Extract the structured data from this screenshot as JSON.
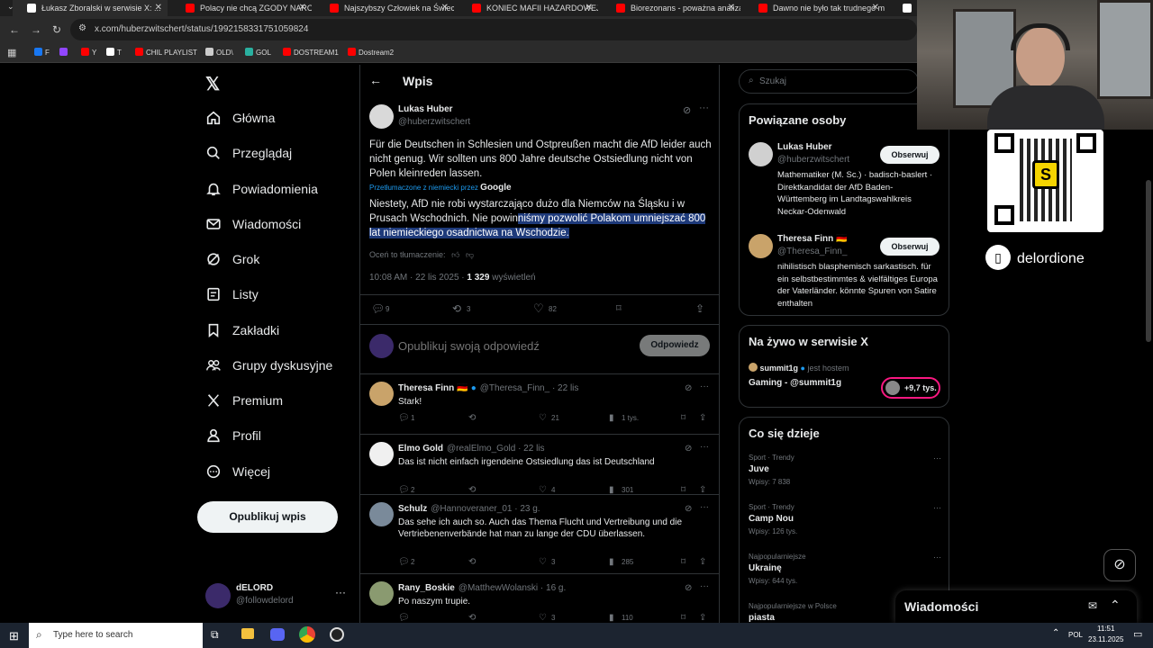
{
  "browser": {
    "tabs": [
      {
        "title": "Łukasz Zboralski w serwisie X: ...",
        "color": "#ffffff"
      },
      {
        "title": "Polacy nie chcą ZGODY NARODOWEJ",
        "color": "#ff0000"
      },
      {
        "title": "Najszybszy Człowiek na Świecie",
        "color": "#ff0000"
      },
      {
        "title": "KONIEC MAFII HAZARDOWEJ",
        "color": "#ff0000"
      },
      {
        "title": "Biorezonans - poważna analiza",
        "color": "#ff0000"
      },
      {
        "title": "Dawno nie było tak trudnego m",
        "color": "#ff0000"
      },
      {
        "title": "Łuka",
        "color": "#ffffff"
      }
    ],
    "url": "x.com/huberzwitschert/status/1992158331751059824",
    "bookmarks": [
      {
        "label": "F",
        "color": "#1877f2"
      },
      {
        "label": "",
        "color": "#9146ff"
      },
      {
        "label": "Y",
        "color": "#ff0000"
      },
      {
        "label": "T",
        "color": "#ffffff"
      },
      {
        "label": "CHIL PLAYLIST",
        "color": "#ff0000"
      },
      {
        "label": "OLD\\",
        "color": "#cccccc"
      },
      {
        "label": "GOL",
        "color": "#2ab0a0"
      },
      {
        "label": "DOSTREAM1",
        "color": "#ff0000"
      },
      {
        "label": "Dostream2",
        "color": "#ff0000"
      }
    ]
  },
  "sidebar": {
    "items": [
      {
        "label": "Główna",
        "icon": "home-icon"
      },
      {
        "label": "Przeglądaj",
        "icon": "search-icon"
      },
      {
        "label": "Powiadomienia",
        "icon": "bell-icon"
      },
      {
        "label": "Wiadomości",
        "icon": "mail-icon"
      },
      {
        "label": "Grok",
        "icon": "grok-icon"
      },
      {
        "label": "Listy",
        "icon": "list-icon"
      },
      {
        "label": "Zakładki",
        "icon": "bookmark-icon"
      },
      {
        "label": "Grupy dyskusyjne",
        "icon": "community-icon"
      },
      {
        "label": "Premium",
        "icon": "x-logo-icon"
      },
      {
        "label": "Profil",
        "icon": "person-icon"
      },
      {
        "label": "Więcej",
        "icon": "more-circle-icon"
      }
    ],
    "post_button": "Opublikuj wpis",
    "account": {
      "name": "dELORD",
      "handle": "@followdelord"
    }
  },
  "post": {
    "header": "Wpis",
    "author": "Lukas Huber",
    "handle": "@huberzwitschert",
    "text_de": "Für die Deutschen in Schlesien und Ostpreußen macht die AfD leider auch nicht genug. Wir sollten uns 800 Jahre deutsche Ostsiedlung nicht von Polen kleinreden lassen.",
    "translated_label": "Przetłumaczone z niemiecki przez",
    "translated_by": "Google",
    "text_pl_plain": "Niestety, AfD nie robi wystarczająco dużo dla Niemców na Śląsku i w Prusach Wschodnich. Nie powin",
    "text_pl_highlight": "niśmy pozwolić Polakom umniejszać 800 lat niemieckiego osadnictwa na Wschodzie.",
    "rate_label": "Oceń to tłumaczenie:",
    "time": "10:08 AM · 22 lis 2025 ·",
    "views_count": "1 329",
    "views_label": "wyświetleń",
    "replies": "9",
    "reposts": "3",
    "likes": "82",
    "reply_placeholder": "Opublikuj swoją odpowiedź",
    "reply_button": "Odpowiedz"
  },
  "replies": [
    {
      "name": "Theresa Finn",
      "flag": "🇩🇪",
      "verified": true,
      "handle": "@Theresa_Finn_ · 22 lis",
      "text": "Stark!",
      "r": "1",
      "rt": "",
      "l": "21",
      "v": "1 tys.",
      "color": "#c9a36a"
    },
    {
      "name": "Elmo Gold",
      "flag": "",
      "verified": false,
      "handle": "@realElmo_Gold · 22 lis",
      "text": "Das ist nicht einfach irgendeine Ostsiedlung das ist Deutschland",
      "r": "2",
      "rt": "",
      "l": "4",
      "v": "301",
      "color": "#f0f0f0"
    },
    {
      "name": "Schulz",
      "flag": "",
      "verified": false,
      "handle": "@Hannoveraner_01 · 23 g.",
      "text": "Das sehe ich auch so. Auch das Thema Flucht und Vertreibung und die Vertriebenenverbände hat man zu lange der CDU überlassen.",
      "r": "2",
      "rt": "",
      "l": "3",
      "v": "285",
      "color": "#7a8a9a"
    },
    {
      "name": "Rany_Boskie",
      "flag": "",
      "verified": false,
      "handle": "@MatthewWolanski · 16 g.",
      "text": "Po naszym trupie.",
      "r": "",
      "rt": "",
      "l": "3",
      "v": "110",
      "color": "#8a9a70"
    }
  ],
  "right": {
    "search_placeholder": "Szukaj",
    "related_title": "Powiązane osoby",
    "related": [
      {
        "name": "Lukas Huber",
        "handle": "@huberzwitschert",
        "bio": "Mathematiker (M. Sc.) · badisch-baslert · Direktkandidat der AfD Baden-Württemberg im Landtagswahlkreis Neckar-Odenwald",
        "button": "Obserwuj"
      },
      {
        "name": "Theresa Finn 🇩🇪",
        "handle": "@Theresa_Finn_",
        "bio": "nihilistisch blasphemisch sarkastisch. für ein selbstbestimmtes & vielfältiges Europa der Vaterländer. könnte Spuren von Satire enthalten",
        "button": "Obserwuj"
      }
    ],
    "live_title": "Na żywo w serwisie X",
    "live_host": "summit1g",
    "live_host_suffix": "jest hostem",
    "live_name": "Gaming - @summit1g",
    "live_count": "+9,7 tys.",
    "trends_title": "Co się dzieje",
    "trends": [
      {
        "context": "Sport · Trendy",
        "name": "Juve",
        "posts": "Wpisy: 7 838"
      },
      {
        "context": "Sport · Trendy",
        "name": "Camp Nou",
        "posts": "Wpisy: 126 tys."
      },
      {
        "context": "Najpopularniejsze",
        "name": "Ukrainę",
        "posts": "Wpisy: 644 tys."
      },
      {
        "context": "Najpopularniejsze w Polsce",
        "name": "piasta",
        "posts": ""
      }
    ],
    "messages_label": "Wiadomości"
  },
  "overlay": {
    "streamer": "delordione"
  },
  "taskbar": {
    "search_placeholder": "Type here to search",
    "lang": "POL",
    "time": "11:51",
    "date": "23.11.2025"
  }
}
